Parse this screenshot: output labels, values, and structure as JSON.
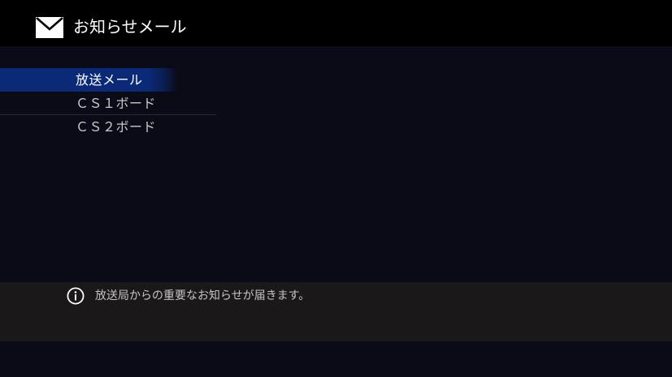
{
  "header": {
    "icon": "mail-icon",
    "title": "お知らせメール"
  },
  "menu": {
    "items": [
      {
        "label": "放送メール",
        "selected": true
      },
      {
        "label": "ＣＳ１ボード",
        "selected": false
      },
      {
        "label": "ＣＳ２ボード",
        "selected": false
      }
    ]
  },
  "info": {
    "icon": "info-icon",
    "text": "放送局からの重要なお知らせが届きます。"
  },
  "colors": {
    "background": "#0b0b18",
    "header": "#000000",
    "selection": "#0a2a78",
    "info_bar": "#1a1818"
  }
}
